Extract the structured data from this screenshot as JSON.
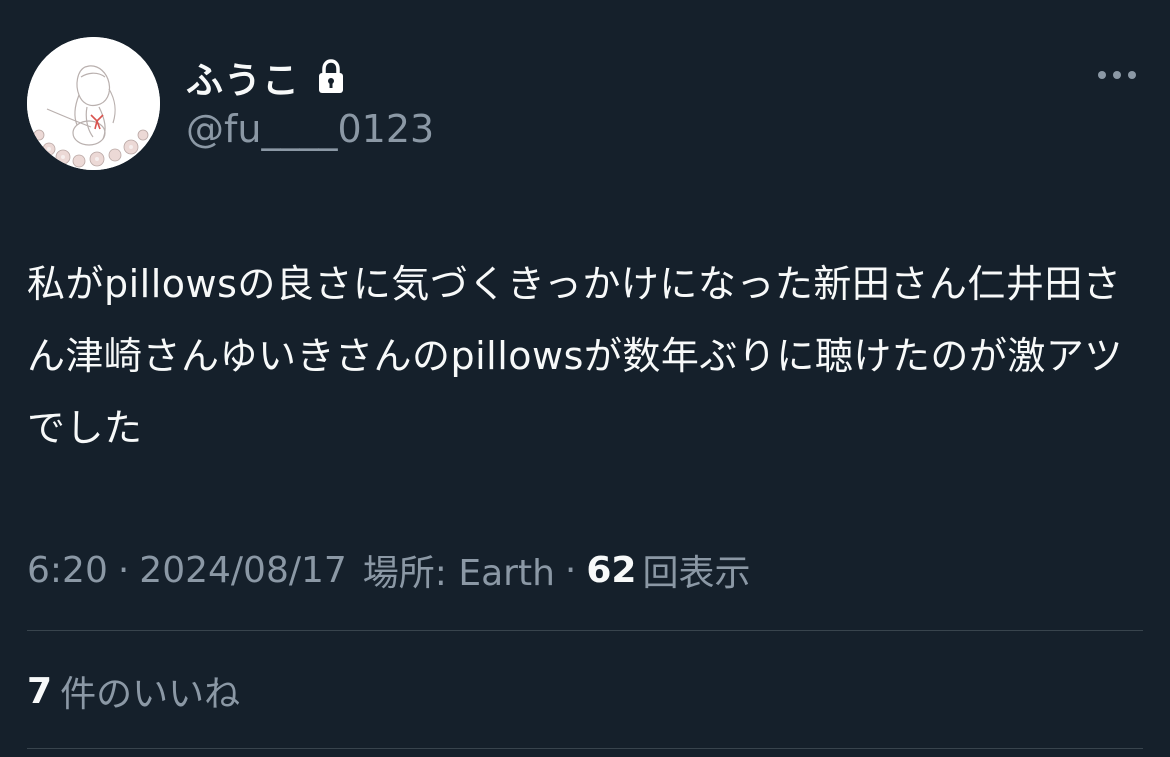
{
  "tweet": {
    "author": {
      "display_name": "ふうこ",
      "handle": "@fu____0123",
      "protected_icon": "lock-icon",
      "avatar": "illustrated-avatar"
    },
    "more_icon": "more-horizontal-icon",
    "text": "私がpillowsの良さに気づくきっかけになった新田さん仁井田さん津崎さんゆいきさんのpillowsが数年ぶりに聴けたのが激アツでした",
    "meta": {
      "time": "6:20",
      "date": "2024/08/17",
      "location": "場所: Earth",
      "views_count": "62",
      "views_label": "回表示",
      "separator": "·"
    },
    "likes": {
      "count": "7",
      "label": "件のいいね"
    }
  },
  "colors": {
    "background": "#15202b",
    "text_primary": "#f7f9f9",
    "text_secondary": "#8b98a5",
    "divider": "#38444d"
  }
}
